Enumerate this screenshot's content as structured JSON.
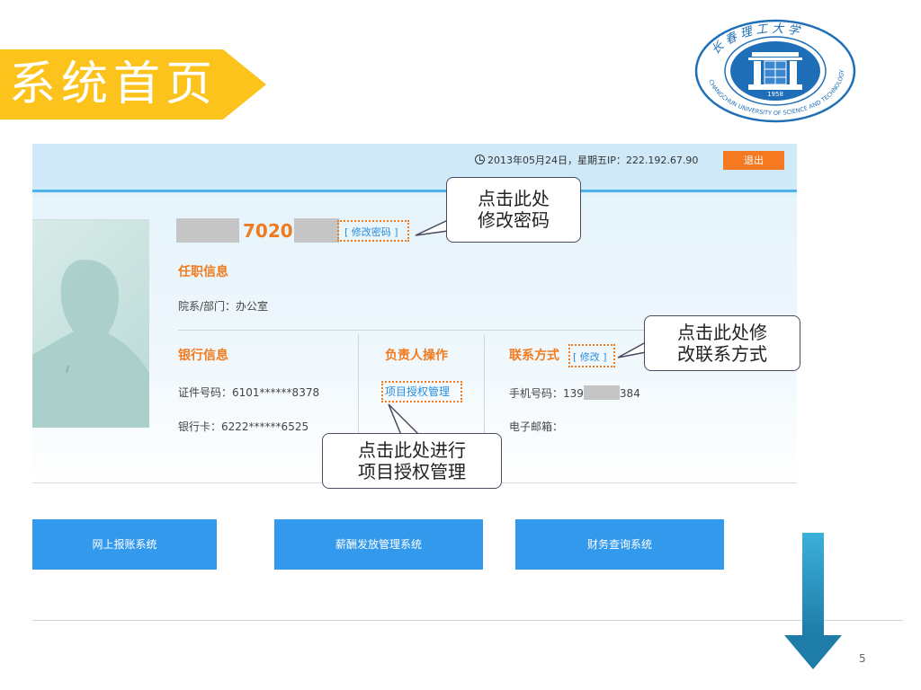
{
  "slide": {
    "title": "系统首页",
    "page_number": "5",
    "banner_color": "#fbc31c"
  },
  "logo": {
    "name": "university-seal",
    "text_top": "长 春 理 工 大 学",
    "text_bottom": "CHANGCHUN UNIVERSITY OF SCIENCE AND TECHNOLOGY",
    "year": "1958",
    "color": "#1f6fb8"
  },
  "header": {
    "datetime": "2013年05月24日，星期五IP：222.192.67.90",
    "logout_label": "退出",
    "logout_color": "#f57921"
  },
  "user": {
    "id_visible": "7020",
    "edit_password_link": "[ 修改密码 ]"
  },
  "job_info": {
    "heading": "任职信息",
    "department_label": "院系/部门：",
    "department_value": "办公室"
  },
  "bank_info": {
    "heading": "银行信息",
    "id_label": "证件号码：",
    "id_value": "6101******8378",
    "card_label": "银行卡：",
    "card_value": "6222******6525"
  },
  "manager_ops": {
    "heading": "负责人操作",
    "project_auth_link": "项目授权管理"
  },
  "contact": {
    "heading": "联系方式",
    "edit_link": "[ 修改 ]",
    "phone_label": "手机号码：",
    "phone_prefix": "139",
    "phone_suffix": "384",
    "email_label": "电子邮箱："
  },
  "systems": [
    {
      "label": "网上报账系统"
    },
    {
      "label": "薪酬发放管理系统"
    },
    {
      "label": "财务查询系统"
    }
  ],
  "callouts": {
    "password": [
      "点击此处",
      "修改密码"
    ],
    "contact": [
      "点击此处修",
      "改联系方式"
    ],
    "project": [
      "点击此处进行",
      "项目授权管理"
    ]
  },
  "colors": {
    "accent_orange": "#f07b1f",
    "link_blue": "#2a8de0",
    "button_blue": "#3399ec",
    "header_line": "#4cb2ea"
  },
  "icons": [
    "clock-icon",
    "down-arrow-icon",
    "avatar-silhouette"
  ]
}
